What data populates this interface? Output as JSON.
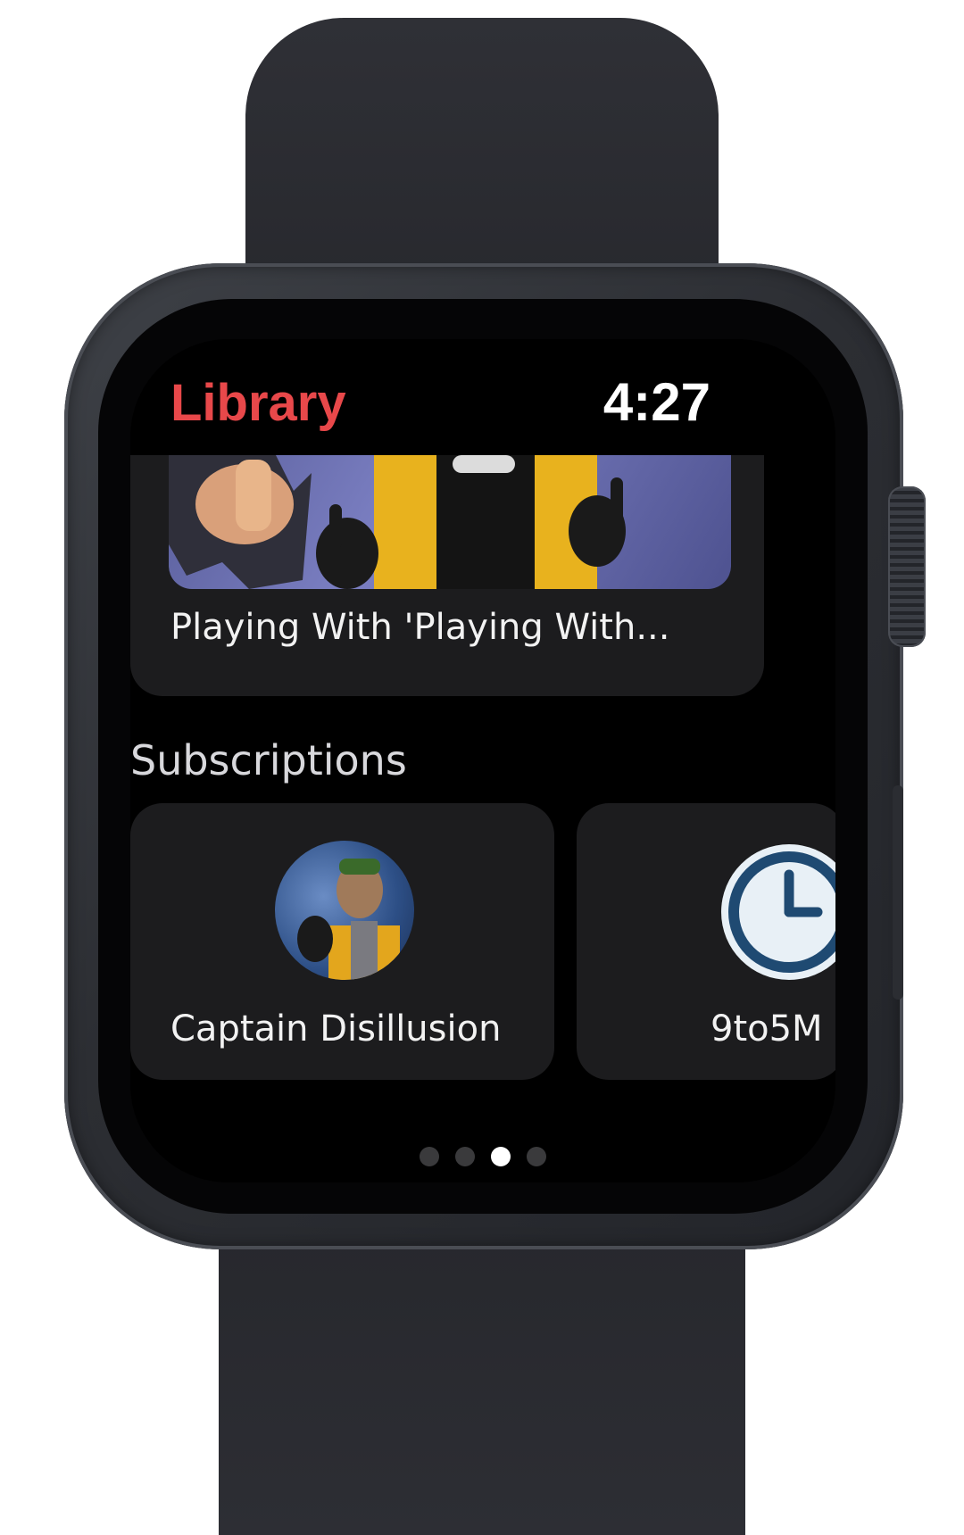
{
  "header": {
    "title": "Library",
    "time": "4:27"
  },
  "video": {
    "title": "Playing With 'Playing With..."
  },
  "subscriptions": {
    "section_title": "Subscriptions",
    "channels": [
      {
        "name": "Captain Disillusion"
      },
      {
        "name": "9to5M"
      }
    ]
  },
  "page_dots": {
    "count": 4,
    "active_index": 2
  },
  "colors": {
    "accent": "#e8484a",
    "card": "#1c1c1e",
    "background": "#000000"
  }
}
